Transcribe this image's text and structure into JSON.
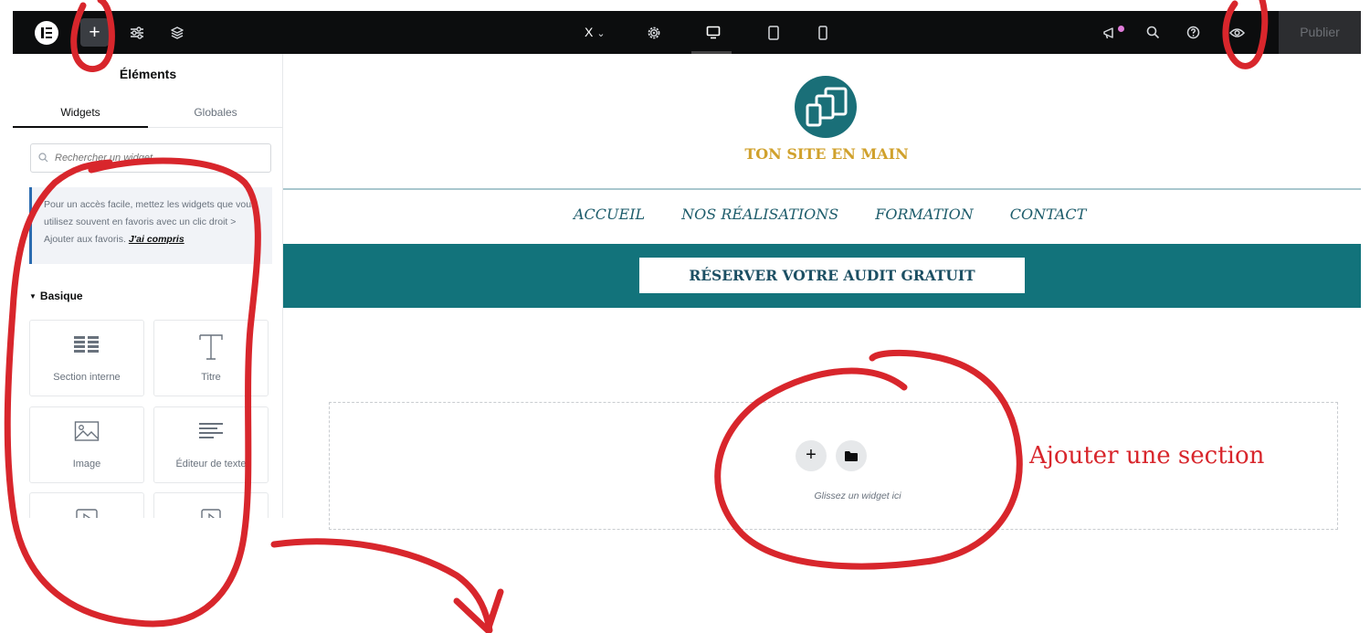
{
  "topbar": {
    "logo_icon": "elementor-logo-icon",
    "add_icon": "plus-icon",
    "settings_icon": "sliders-icon",
    "structure_icon": "layers-icon",
    "page_selector_label": "X",
    "site_settings_icon": "gear-icon",
    "devices": [
      "desktop-icon",
      "tablet-icon",
      "mobile-icon"
    ],
    "notifications_icon": "megaphone-icon",
    "search_icon": "search-icon",
    "help_icon": "help-icon",
    "preview_icon": "eye-icon",
    "publish_label": "Publier"
  },
  "panel": {
    "title": "Éléments",
    "tabs": [
      {
        "label": "Widgets",
        "active": true
      },
      {
        "label": "Globales",
        "active": false
      }
    ],
    "search_placeholder": "Rechercher un widget",
    "info": {
      "text": "Pour un accès facile, mettez les widgets que vous utilisez souvent en favoris avec un clic droit > Ajouter aux favoris.",
      "link": "J'ai compris"
    },
    "category": "Basique",
    "widgets": [
      {
        "label": "Section interne",
        "icon": "inner-section-icon"
      },
      {
        "label": "Titre",
        "icon": "heading-icon"
      },
      {
        "label": "Image",
        "icon": "image-icon"
      },
      {
        "label": "Éditeur de texte",
        "icon": "text-editor-icon"
      },
      {
        "label": "",
        "icon": "video-icon"
      },
      {
        "label": "",
        "icon": "button-icon"
      }
    ]
  },
  "site": {
    "name": "TON SITE EN MAIN",
    "nav": [
      "ACCUEIL",
      "NOS RÉALISATIONS",
      "FORMATION",
      "CONTACT"
    ],
    "cta_label": "RÉSERVER VOTRE AUDIT GRATUIT",
    "drop_hint": "Glissez un widget ici"
  },
  "annotation": {
    "text": "Ajouter une section",
    "color": "#d8262c"
  },
  "colors": {
    "topbar_bg": "#0c0d0e",
    "teal": "#12737b",
    "gold": "#d0a12c",
    "nav_text": "#1d5c6b"
  }
}
